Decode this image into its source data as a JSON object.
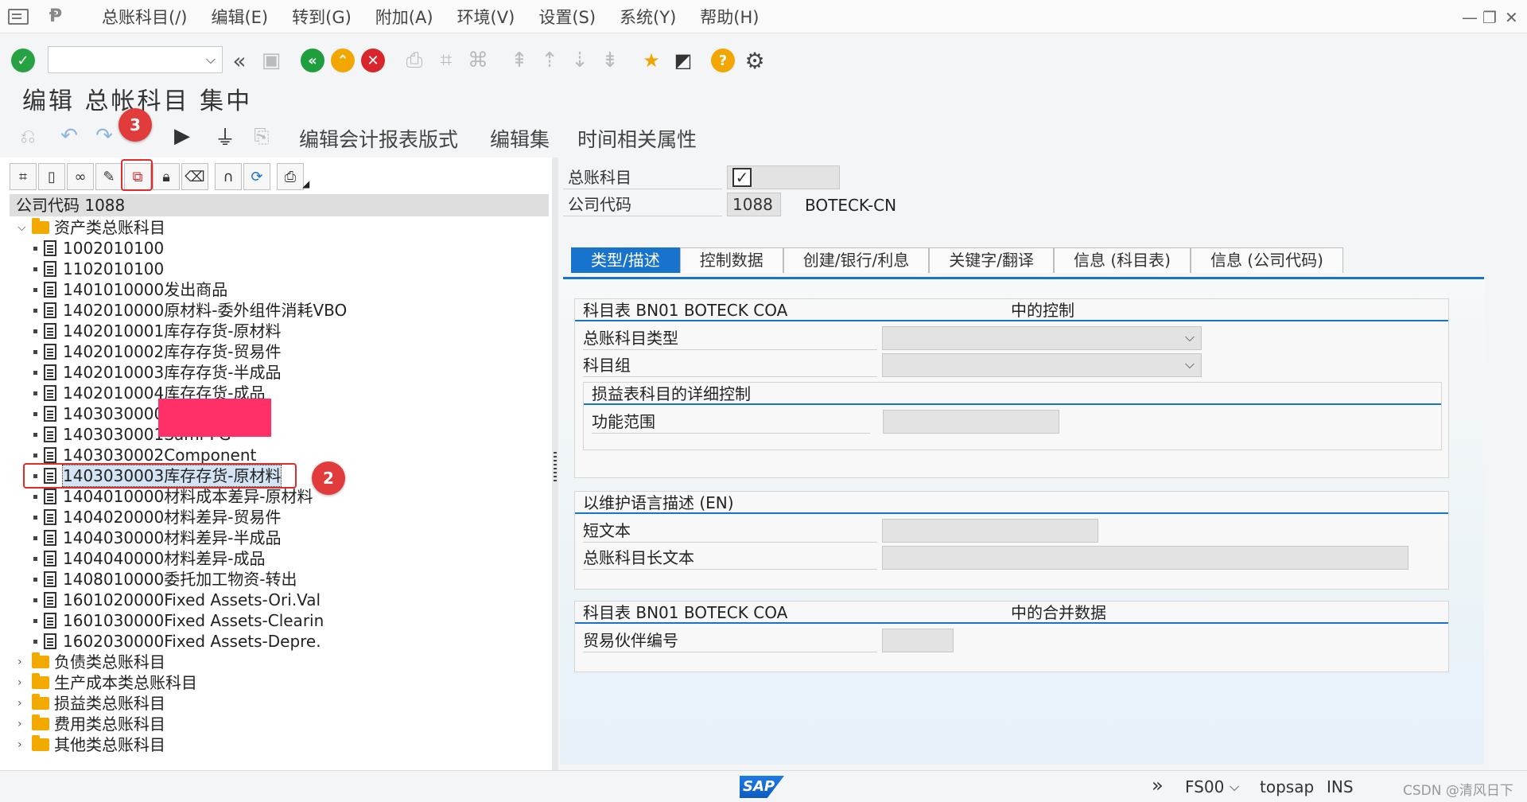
{
  "menu": {
    "items": [
      "总账科目(/)",
      "编辑(E)",
      "转到(G)",
      "附加(A)",
      "环境(V)",
      "设置(S)",
      "系统(Y)",
      "帮助(H)"
    ]
  },
  "window_controls": {
    "minimize": "—",
    "restore": "❐",
    "close": "✕"
  },
  "page_title": "编辑 总帐科目 集中",
  "app_toolbar": {
    "items": [
      "编辑会计报表版式",
      "编辑集",
      "时间相关属性"
    ]
  },
  "badges": {
    "one": "2",
    "two": "3"
  },
  "tree": {
    "header": "公司代码 1088",
    "asset_folder": "资产类总账科目",
    "asset_items": [
      "1002010100",
      "1102010100",
      "1401010000发出商品",
      "1402010000原材料-委外组件消耗VBO",
      "1402010001库存存货-原材料",
      "1402010002库存存货-贸易件",
      "1402010003库存存货-半成品",
      "1402010004库存存货-成品",
      "1403030000FG",
      "1403030001Sami-FG",
      "1403030002Component",
      "1403030003库存存货-原材料",
      "1404010000材料成本差异-原材料",
      "1404020000材料差异-贸易件",
      "1404030000材料差异-半成品",
      "1404040000材料差异-成品",
      "1408010000委托加工物资-转出",
      "1601020000Fixed Assets-Ori.Val",
      "1601030000Fixed Assets-Clearin",
      "1602030000Fixed Assets-Depre."
    ],
    "other_folders": [
      "负债类总账科目",
      "生产成本类总账科目",
      "损益类总账科目",
      "费用类总账科目",
      "其他类总账科目"
    ]
  },
  "detail": {
    "gl_account_label": "总账科目",
    "gl_account_checked": "✓",
    "company_code_label": "公司代码",
    "company_code_value": "1088",
    "company_name": "BOTECK-CN",
    "tabs": [
      "类型/描述",
      "控制数据",
      "创建/银行/利息",
      "关键字/翻译",
      "信息 (科目表)",
      "信息 (公司代码)"
    ],
    "group1": {
      "title_left": "科目表 BN01 BOTECK COA",
      "title_right": "中的控制",
      "field1": "总账科目类型",
      "field2": "科目组",
      "subgroup_title": "损益表科目的详细控制",
      "field3": "功能范围"
    },
    "group2": {
      "title": "以维护语言描述 (EN)",
      "field1": "短文本",
      "field2": "总账科目长文本"
    },
    "group3": {
      "title_left": "科目表 BN01 BOTECK COA",
      "title_right": "中的合并数据",
      "field1": "贸易伙伴编号"
    }
  },
  "status": {
    "tcode": "FS00",
    "system": "topsap",
    "mode": "INS",
    "watermark": "CSDN @清风日下"
  }
}
